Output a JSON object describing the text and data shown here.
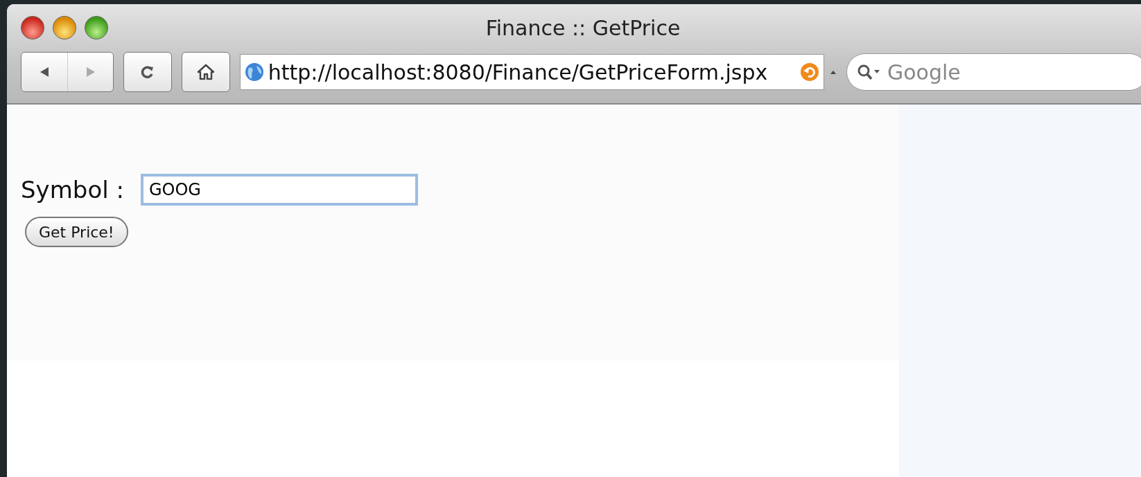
{
  "window": {
    "title": "Finance :: GetPrice"
  },
  "toolbar": {
    "address": "http://localhost:8080/Finance/GetPriceForm.jspx",
    "search": {
      "placeholder": "Google"
    }
  },
  "form": {
    "label": "Symbol :",
    "symbol": "GOOG",
    "button": "Get Price!"
  }
}
